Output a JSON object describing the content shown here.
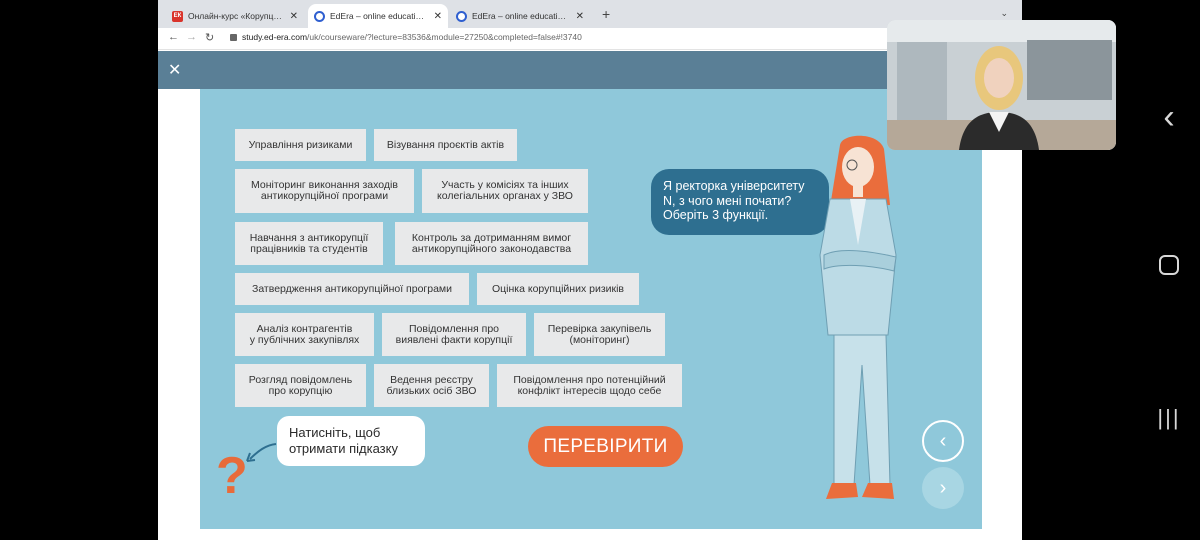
{
  "browser": {
    "tabs": [
      {
        "label": "Онлайн-курс «Корупція-off»",
        "favicon": "ek-favicon",
        "active": false
      },
      {
        "label": "EdEra – online education studio",
        "favicon": "edera-favicon",
        "active": true
      },
      {
        "label": "EdEra – online education studio",
        "favicon": "edera-favicon",
        "active": false
      }
    ],
    "new_tab": "+",
    "url_host": "study.ed-era.com",
    "url_path": "/uk/courseware/?lecture=83536&module=27250&completed=false#!3740"
  },
  "app": {
    "close_glyph": "✕"
  },
  "slide": {
    "cards": [
      "Управління ризиками",
      "Візування проєктів актів",
      "Моніторинг виконання заходів\nантикорупційної програми",
      "Участь у комісіях та інших\nколегіальних органах у ЗВО",
      "Навчання з антикорупції\nпрацівників та студентів",
      "Контроль за дотриманням вимог\nантикорупційного законодавства",
      "Затвердження антикорупційної програми",
      "Оцінка корупційних ризиків",
      "Аналіз контрагентів\nу публічних закупівлях",
      "Повідомлення про\nвиявлені факти корупції",
      "Перевірка закупівель\n(моніторинг)",
      "Розгляд повідомлень\nпро корупцію",
      "Ведення реєстру\nблизьких осіб ЗВО",
      "Повідомлення про потенційний\nконфлікт інтересів щодо себе"
    ],
    "speech_bubble": "Я ректорка університету N, з чого мені почати? Оберіть 3 функції.",
    "hint_text": "Натисніть, щоб отримати підказку",
    "question_mark": "?",
    "check_button": "ПЕРЕВІРИТИ",
    "prev_glyph": "‹",
    "next_glyph": "›"
  },
  "android": {
    "back_glyph": "‹",
    "recent_glyph": "|||"
  },
  "colors": {
    "slide_bg": "#8fc8da",
    "header_bg": "#5a7f96",
    "accent_orange": "#ea6d3c",
    "bubble_blue": "#2e6f90",
    "card_bg": "#e8e9ea"
  }
}
